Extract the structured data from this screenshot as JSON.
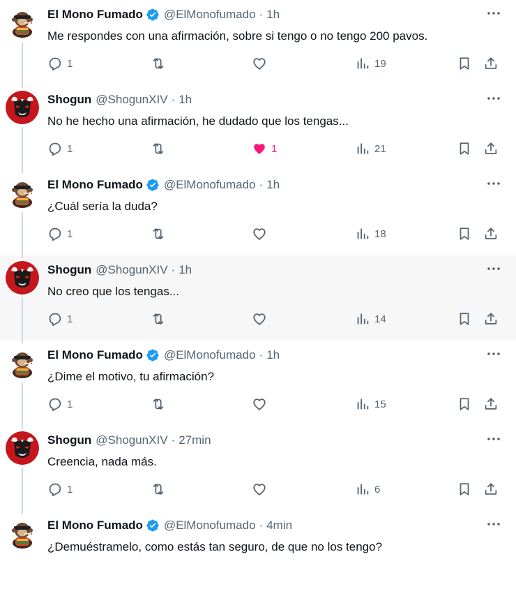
{
  "colors": {
    "text": "#0f1419",
    "muted": "#536471",
    "verified": "#1d9bf0",
    "like_active": "#f91880",
    "thread_line": "#cfd9de",
    "highlight_bg": "#f7f7f7"
  },
  "icons": {
    "reply": "reply-icon",
    "retweet": "retweet-icon",
    "like": "heart-icon",
    "views": "bar-chart-icon",
    "bookmark": "bookmark-icon",
    "share": "share-icon",
    "more": "more-icon",
    "verified": "verified-badge-icon"
  },
  "tweets": [
    {
      "author": "El Mono Fumado",
      "handle": "@ElMonofumado",
      "verified": true,
      "time": "1h",
      "text": "Me respondes con una afirmación, sobre si tengo o no tengo 200 pavos.",
      "replies": "1",
      "retweets": "",
      "likes": "",
      "liked": false,
      "views": "19"
    },
    {
      "author": "Shogun",
      "handle": "@ShogunXIV",
      "verified": false,
      "time": "1h",
      "text": "No he hecho una afirmación, he dudado que los tengas...",
      "replies": "1",
      "retweets": "",
      "likes": "1",
      "liked": true,
      "views": "21"
    },
    {
      "author": "El Mono Fumado",
      "handle": "@ElMonofumado",
      "verified": true,
      "time": "1h",
      "text": "¿Cuál sería la duda?",
      "replies": "1",
      "retweets": "",
      "likes": "",
      "liked": false,
      "views": "18"
    },
    {
      "author": "Shogun",
      "handle": "@ShogunXIV",
      "verified": false,
      "time": "1h",
      "text": "No creo que los tengas...",
      "replies": "1",
      "retweets": "",
      "likes": "",
      "liked": false,
      "views": "14"
    },
    {
      "author": "El Mono Fumado",
      "handle": "@ElMonofumado",
      "verified": true,
      "time": "1h",
      "text": "¿Dime el motivo, tu afirmación?",
      "replies": "1",
      "retweets": "",
      "likes": "",
      "liked": false,
      "views": "15"
    },
    {
      "author": "Shogun",
      "handle": "@ShogunXIV",
      "verified": false,
      "time": "27min",
      "text": "Creencia, nada más.",
      "replies": "1",
      "retweets": "",
      "likes": "",
      "liked": false,
      "views": "6"
    },
    {
      "author": "El Mono Fumado",
      "handle": "@ElMonofumado",
      "verified": true,
      "time": "4min",
      "text": "¿Demuéstramelo, como estás tan seguro, de que no los tengo?",
      "replies": "",
      "retweets": "",
      "likes": "",
      "liked": false,
      "views": ""
    }
  ]
}
